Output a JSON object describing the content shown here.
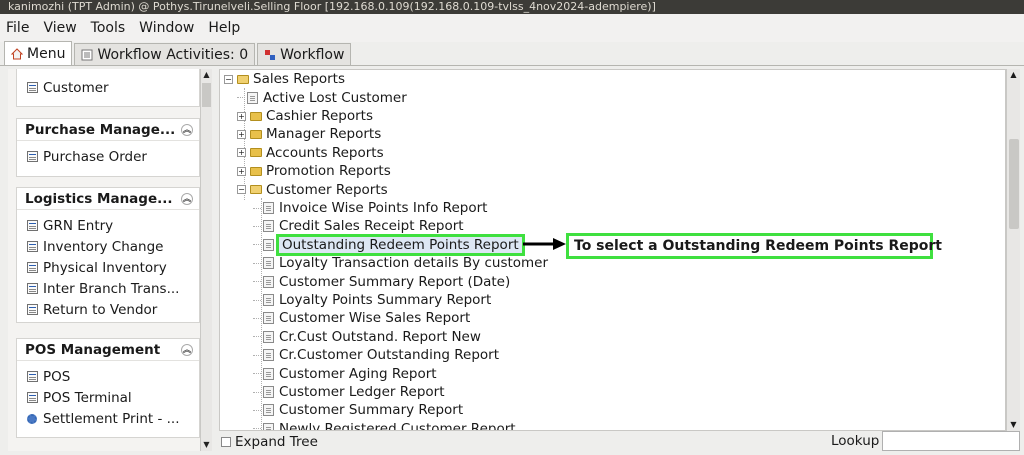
{
  "window": {
    "title": "kanimozhi (TPT Admin) @ Pothys.Tirunelveli.Selling Floor [192.168.0.109(192.168.0.109-tvlss_4nov2024-adempiere)]"
  },
  "menubar": {
    "items": [
      "File",
      "View",
      "Tools",
      "Window",
      "Help"
    ]
  },
  "tabs": {
    "menu": "Menu",
    "workflow_activities": "Workflow Activities: 0",
    "workflow": "Workflow"
  },
  "left_panel": {
    "top_item": "Customer",
    "sections": [
      {
        "title": "Purchase Manage...",
        "items": [
          "Purchase Order"
        ]
      },
      {
        "title": "Logistics Manage...",
        "items": [
          "GRN Entry",
          "Inventory Change",
          "Physical Inventory",
          "Inter Branch Trans...",
          "Return to Vendor"
        ]
      },
      {
        "title": "POS Management",
        "items": [
          "POS",
          "POS Terminal",
          "Settlement Print - ..."
        ]
      }
    ]
  },
  "tree": {
    "root": "Sales Reports",
    "items": [
      {
        "label": "Active Lost Customer",
        "type": "doc",
        "level": 1
      },
      {
        "label": "Cashier Reports",
        "type": "folder",
        "level": 1
      },
      {
        "label": "Manager Reports",
        "type": "folder",
        "level": 1
      },
      {
        "label": "Accounts Reports",
        "type": "folder",
        "level": 1
      },
      {
        "label": "Promotion Reports",
        "type": "folder",
        "level": 1
      },
      {
        "label": "Customer Reports",
        "type": "folder-open",
        "level": 1
      },
      {
        "label": "Invoice Wise Points Info Report",
        "type": "doc",
        "level": 2
      },
      {
        "label": "Credit Sales Receipt Report",
        "type": "doc",
        "level": 2
      },
      {
        "label": "Outstanding Redeem Points Report",
        "type": "doc",
        "level": 2,
        "selected": true
      },
      {
        "label": "Loyalty Transaction details By customer",
        "type": "doc",
        "level": 2
      },
      {
        "label": "Customer Summary Report (Date)",
        "type": "doc",
        "level": 2
      },
      {
        "label": "Loyalty Points Summary Report",
        "type": "doc",
        "level": 2
      },
      {
        "label": "Customer Wise Sales Report",
        "type": "doc",
        "level": 2
      },
      {
        "label": "Cr.Cust Outstand. Report New",
        "type": "doc",
        "level": 2
      },
      {
        "label": "Cr.Customer Outstanding Report",
        "type": "doc",
        "level": 2
      },
      {
        "label": "Customer Aging Report",
        "type": "doc",
        "level": 2
      },
      {
        "label": "Customer Ledger Report",
        "type": "doc",
        "level": 2
      },
      {
        "label": "Customer Summary Report",
        "type": "doc",
        "level": 2
      },
      {
        "label": "Newly Registered Customer Report",
        "type": "doc",
        "level": 2
      }
    ]
  },
  "annotation": {
    "text": "To select a Outstanding Redeem Points Report",
    "color": "#3fe03f"
  },
  "bottom": {
    "expand_tree": "Expand Tree",
    "lookup": "Lookup",
    "lookup_value": ""
  }
}
